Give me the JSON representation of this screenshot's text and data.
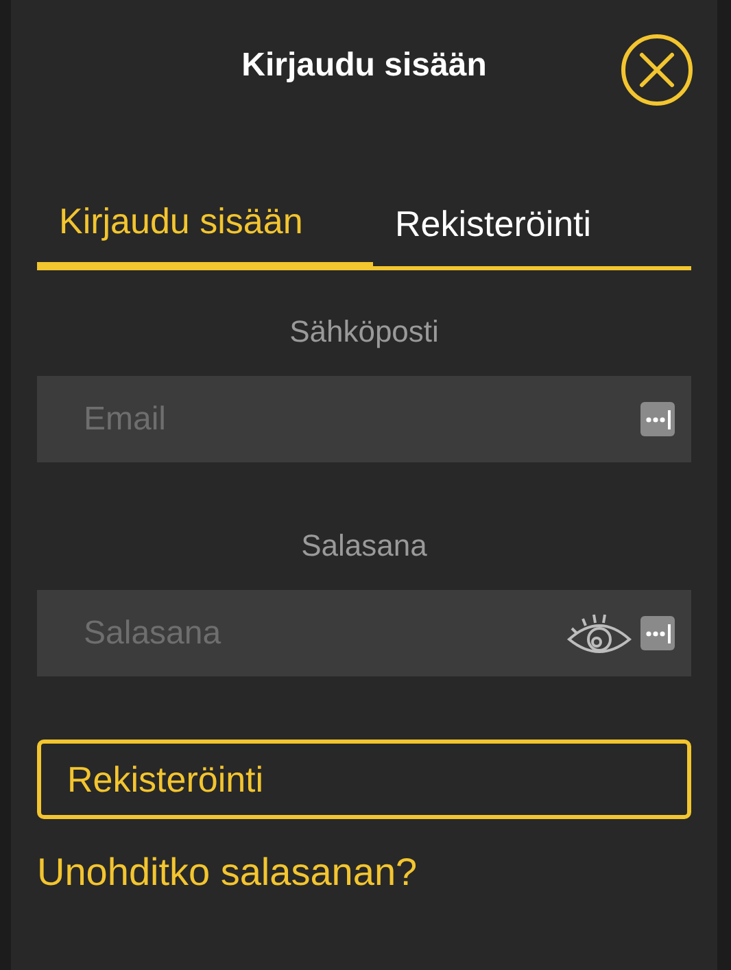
{
  "dialog": {
    "title": "Kirjaudu sisään"
  },
  "tabs": [
    {
      "label": "Kirjaudu sisään",
      "selected": true
    },
    {
      "label": "Rekisteröinti",
      "selected": false
    }
  ],
  "fields": [
    {
      "label": "Sähköposti",
      "placeholder": "Email",
      "kind": "email"
    },
    {
      "label": "Salasana",
      "placeholder": "Salasana",
      "kind": "password"
    }
  ],
  "register_button": "Rekisteröinti",
  "forgot_link": "Unohditko salasanan?"
}
